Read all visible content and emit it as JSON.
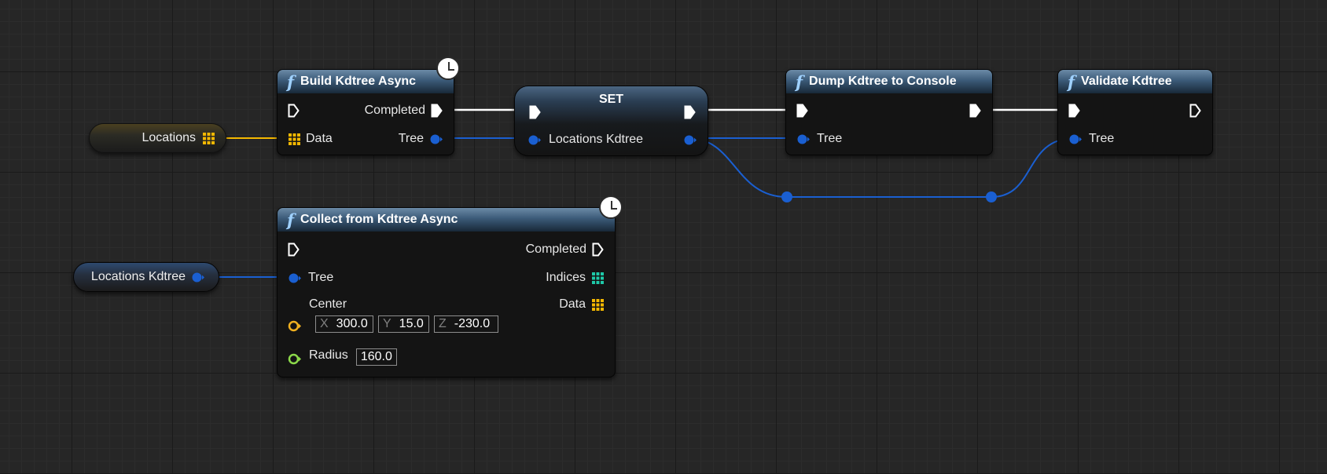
{
  "nodes": {
    "build": {
      "title": "Build Kdtree Async",
      "out_exec": "Completed",
      "in_data": "Data",
      "out_tree": "Tree"
    },
    "set": {
      "title": "SET",
      "var_label": "Locations Kdtree"
    },
    "dump": {
      "title": "Dump Kdtree to Console",
      "in_tree": "Tree"
    },
    "validate": {
      "title": "Validate Kdtree",
      "in_tree": "Tree"
    },
    "collect": {
      "title": "Collect from Kdtree Async",
      "out_exec": "Completed",
      "in_tree": "Tree",
      "out_indices": "Indices",
      "out_data": "Data",
      "center_label": "Center",
      "center_x_axis": "X",
      "center_x": "300.0",
      "center_y_axis": "Y",
      "center_y": "15.0",
      "center_z_axis": "Z",
      "center_z": "-230.0",
      "radius_label": "Radius",
      "radius_value": "160.0"
    }
  },
  "vars": {
    "locations": "Locations",
    "locations_kdtree": "Locations Kdtree"
  },
  "colors": {
    "exec": "#ffffff",
    "object": "#1a5fd1",
    "array_struct": "#f5b800",
    "vector": "#f0b020",
    "float": "#8cd94a",
    "int_array": "#1ec9a8",
    "header_top": "#6b8aa6",
    "header_bottom": "#182838"
  },
  "icons": {
    "function": "f",
    "latent": "clock-icon"
  }
}
